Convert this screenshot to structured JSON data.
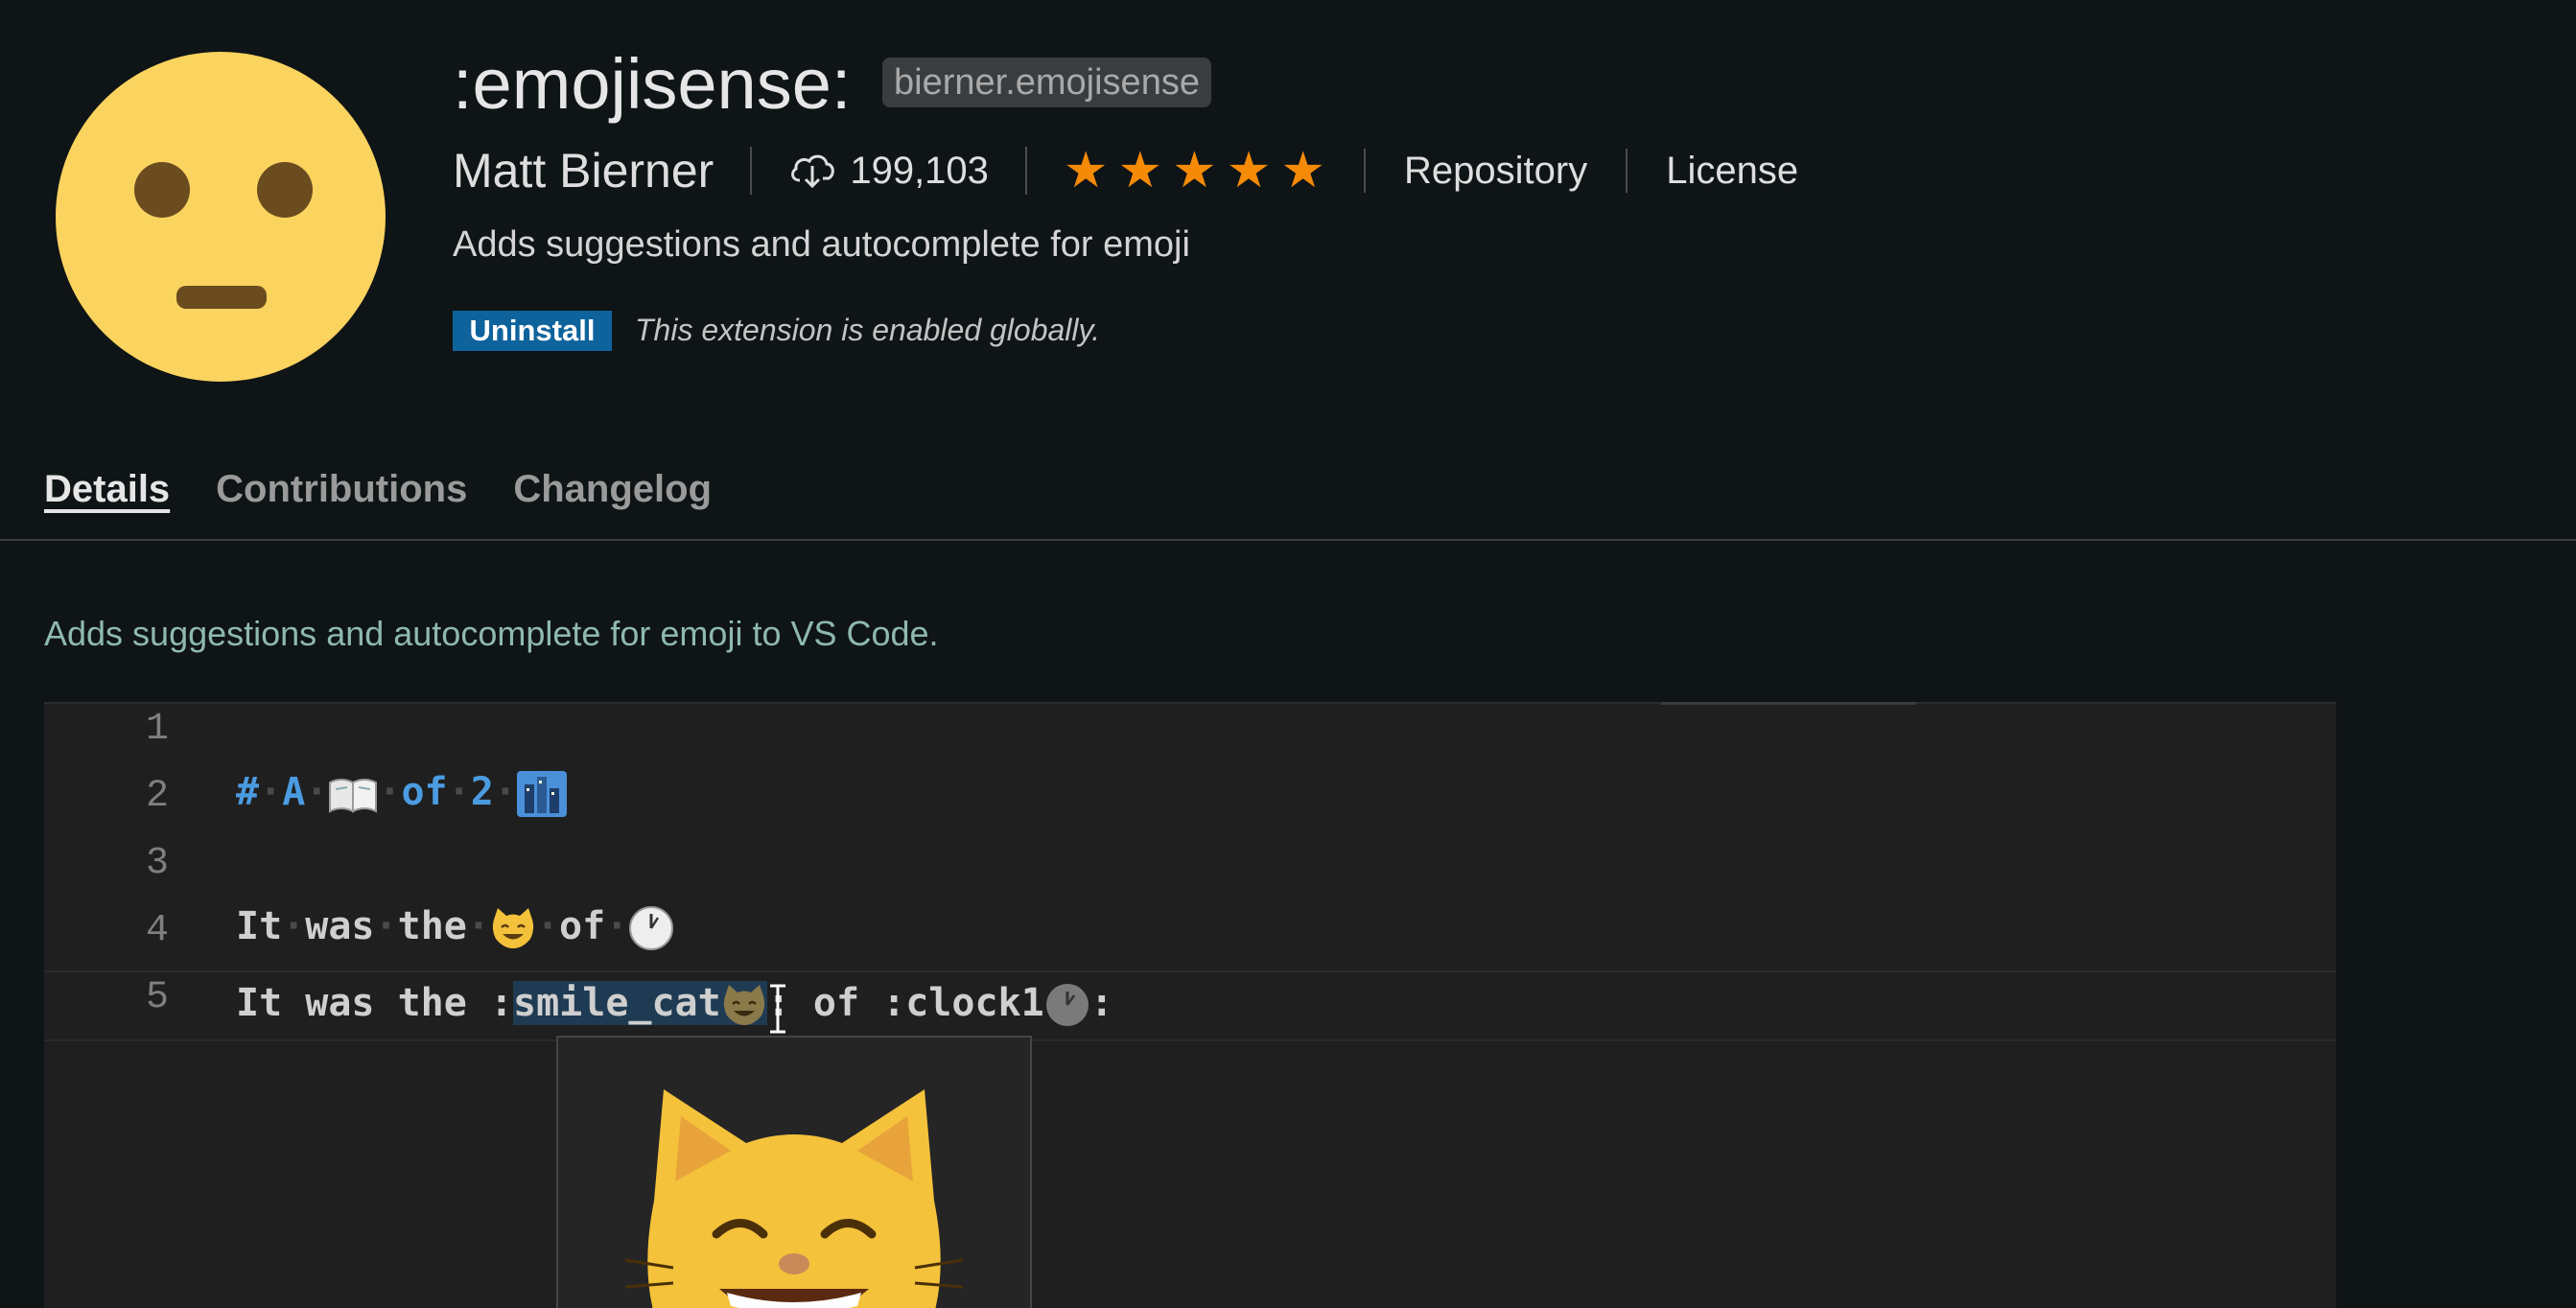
{
  "header": {
    "title": ":emojisense:",
    "extension_id": "bierner.emojisense",
    "author": "Matt Bierner",
    "install_count": "199,103",
    "rating_stars": 5,
    "repository_link": "Repository",
    "license_link": "License",
    "description": "Adds suggestions and autocomplete for emoji",
    "uninstall_label": "Uninstall",
    "enabled_note": "This extension is enabled globally."
  },
  "tabs": [
    {
      "label": "Details",
      "active": true
    },
    {
      "label": "Contributions",
      "active": false
    },
    {
      "label": "Changelog",
      "active": false
    }
  ],
  "readme": {
    "intro": "Adds suggestions and autocomplete for emoji to VS Code."
  },
  "editor": {
    "line_numbers": [
      "1",
      "2",
      "3",
      "4",
      "5"
    ],
    "line2": {
      "hash": "#",
      "a": "A",
      "of": "of",
      "two": "2"
    },
    "line4": {
      "text1": "It",
      "text2": "was",
      "text3": "the",
      "text4": "of"
    },
    "line5": {
      "prefix": "It was the :",
      "selected": "smile_cat",
      "middle": ": of :clock1",
      "suffix": ":"
    }
  },
  "colors": {
    "background": "#0f1416",
    "accent_button": "#0e639c",
    "star": "#f58a07",
    "readme_text": "#8fb9ae",
    "markdown_heading": "#4b9be0"
  },
  "icons": {
    "extension_logo": "neutral-face-icon",
    "downloads": "cloud-download-icon",
    "rating": "star-icon",
    "line2_emoji1": "open-book-icon",
    "line2_emoji2": "cityscape-icon",
    "line4_emoji1": "smile-cat-icon",
    "line4_emoji2": "clock1-icon",
    "line5_emoji1": "smile-cat-icon",
    "line5_emoji2": "clock1-icon",
    "popup_preview": "smile-cat-icon"
  }
}
